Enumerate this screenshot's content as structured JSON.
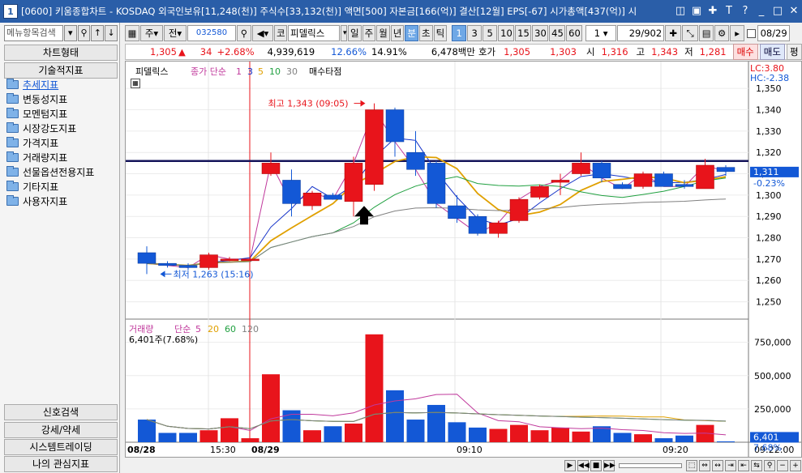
{
  "window": {
    "number": "1",
    "title": "[0600] 키움종합차트 - KOSDAQ 외국인보유[11,248(천)] 주식수[33,132(천)] 액면[500] 자본금[166(억)] 결산[12월] EPS[-67] 시가총액[437(억)] 시"
  },
  "sidebar": {
    "search_placeholder": "메뉴항목검색",
    "headers": [
      "차트형태",
      "기술적지표"
    ],
    "items": [
      "추세지표",
      "변동성지표",
      "모멘텀지표",
      "시장강도지표",
      "가격지표",
      "거래량지표",
      "선물옵션전용지표",
      "기타지표",
      "사용자지표"
    ],
    "bottom_headers": [
      "신호검색",
      "강세/약세",
      "시스템트레이딩",
      "나의 관심지표"
    ]
  },
  "toolbar": {
    "market": "주",
    "period": "전",
    "code": "032580",
    "kind": "코",
    "stock_name": "피델릭스",
    "timeframes": [
      "일",
      "주",
      "월",
      "년",
      "분",
      "초",
      "틱"
    ],
    "active_timeframe": "분",
    "intervals": [
      "1",
      "3",
      "5",
      "10",
      "15",
      "30",
      "45",
      "60"
    ],
    "active_interval": "1",
    "unit": "1",
    "count": "29",
    "total": "/902",
    "date": "08/29"
  },
  "info": {
    "price": "1,305",
    "change": "34",
    "change_pct": "+2.68%",
    "volume": "4,939,619",
    "turnover_pct": "12.66%",
    "rate2": "14.91%",
    "amount": "6,478백만",
    "quote_label": "호가",
    "ask": "1,305",
    "bid": "1,303",
    "open_label": "시",
    "open": "1,316",
    "high_label": "고",
    "high": "1,343",
    "low_label": "저",
    "low": "1,281",
    "buy": "매수",
    "sell": "매도",
    "eval": "평"
  },
  "price_panel": {
    "stock": "피델릭스",
    "ma_label": "종가 단순",
    "ma_periods": [
      "1",
      "3",
      "5",
      "10",
      "30"
    ],
    "ma_colors": [
      "#c0399c",
      "#1432c8",
      "#e0a000",
      "#20a040",
      "#808080"
    ],
    "signal_label": "매수타점",
    "lc": "LC:3.80",
    "hc": "HC:-2.38",
    "high_annotation": "최고 1,343 (09:05)",
    "low_annotation": "최저 1,263 (15:16)",
    "current_price": "1,311",
    "current_pct": "-0.23%",
    "ticks": [
      "1,350",
      "1,340",
      "1,330",
      "1,320",
      "1,310",
      "1,300",
      "1,290",
      "1,280",
      "1,270",
      "1,260",
      "1,250"
    ]
  },
  "volume_panel": {
    "label": "거래량",
    "ma_label": "단순",
    "ma_periods": [
      "5",
      "20",
      "60",
      "120"
    ],
    "ma_colors": [
      "#c0399c",
      "#e0a000",
      "#20a040",
      "#808080"
    ],
    "summary": "6,401주(7.68%)",
    "current": "6,401",
    "current_pct": "7.68%",
    "ticks": [
      "750,000",
      "500,000",
      "250,000"
    ]
  },
  "x_axis": [
    "08/28",
    "15:30",
    "08/29",
    "09:10",
    "09:20",
    "09:22:00"
  ],
  "chart_data": {
    "type": "candlestick",
    "candles": [
      {
        "o": 1273,
        "h": 1276,
        "l": 1263,
        "c": 1268,
        "v": 170000
      },
      {
        "o": 1268,
        "h": 1269,
        "l": 1266,
        "c": 1267,
        "v": 70000
      },
      {
        "o": 1267,
        "h": 1268,
        "l": 1265,
        "c": 1266,
        "v": 70000
      },
      {
        "o": 1266,
        "h": 1273,
        "l": 1265,
        "c": 1272,
        "v": 90000
      },
      {
        "o": 1270,
        "h": 1271,
        "l": 1269,
        "c": 1270,
        "v": 180000
      },
      {
        "o": 1270,
        "h": 1271,
        "l": 1269,
        "c": 1270,
        "v": 30000
      },
      {
        "o": 1310,
        "h": 1320,
        "l": 1309,
        "c": 1315,
        "v": 510000
      },
      {
        "o": 1307,
        "h": 1312,
        "l": 1290,
        "c": 1296,
        "v": 240000
      },
      {
        "o": 1295,
        "h": 1302,
        "l": 1293,
        "c": 1301,
        "v": 90000
      },
      {
        "o": 1300,
        "h": 1301,
        "l": 1298,
        "c": 1298,
        "v": 120000
      },
      {
        "o": 1297,
        "h": 1318,
        "l": 1290,
        "c": 1315,
        "v": 140000
      },
      {
        "o": 1305,
        "h": 1343,
        "l": 1302,
        "c": 1340,
        "v": 810000
      },
      {
        "o": 1340,
        "h": 1341,
        "l": 1318,
        "c": 1325,
        "v": 390000
      },
      {
        "o": 1320,
        "h": 1330,
        "l": 1309,
        "c": 1312,
        "v": 170000
      },
      {
        "o": 1315,
        "h": 1316,
        "l": 1294,
        "c": 1296,
        "v": 280000
      },
      {
        "o": 1295,
        "h": 1300,
        "l": 1287,
        "c": 1289,
        "v": 150000
      },
      {
        "o": 1290,
        "h": 1291,
        "l": 1281,
        "c": 1282,
        "v": 110000
      },
      {
        "o": 1282,
        "h": 1288,
        "l": 1280,
        "c": 1287,
        "v": 100000
      },
      {
        "o": 1288,
        "h": 1299,
        "l": 1287,
        "c": 1298,
        "v": 130000
      },
      {
        "o": 1299,
        "h": 1305,
        "l": 1298,
        "c": 1304,
        "v": 90000
      },
      {
        "o": 1306,
        "h": 1310,
        "l": 1300,
        "c": 1307,
        "v": 110000
      },
      {
        "o": 1310,
        "h": 1320,
        "l": 1309,
        "c": 1315,
        "v": 80000
      },
      {
        "o": 1315,
        "h": 1316,
        "l": 1306,
        "c": 1308,
        "v": 120000
      },
      {
        "o": 1305,
        "h": 1306,
        "l": 1303,
        "c": 1303,
        "v": 70000
      },
      {
        "o": 1304,
        "h": 1311,
        "l": 1303,
        "c": 1310,
        "v": 60000
      },
      {
        "o": 1310,
        "h": 1311,
        "l": 1304,
        "c": 1304,
        "v": 30000
      },
      {
        "o": 1305,
        "h": 1307,
        "l": 1303,
        "c": 1304,
        "v": 50000
      },
      {
        "o": 1303,
        "h": 1317,
        "l": 1303,
        "c": 1314,
        "v": 130000
      },
      {
        "o": 1313,
        "h": 1314,
        "l": 1309,
        "c": 1311,
        "v": 6401
      }
    ],
    "price_range": [
      1243,
      1355
    ],
    "volume_range": [
      0,
      900000
    ],
    "reference_line": 1316,
    "up_color": "#e8141b",
    "down_color": "#1358d6"
  }
}
